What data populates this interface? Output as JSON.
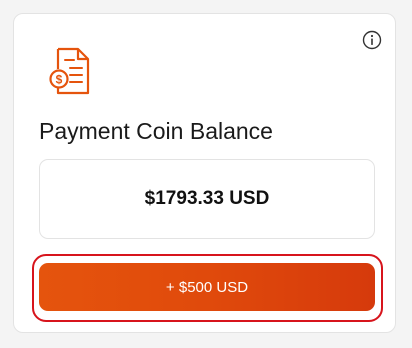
{
  "card": {
    "title": "Payment Coin Balance",
    "balance": "$1793.33 USD",
    "add_button_label": "+ $500 USD"
  },
  "icons": {
    "info": "info-icon",
    "document": "invoice-document-icon"
  },
  "colors": {
    "accent": "#e5540d",
    "accent_dark": "#d63a0c",
    "focus_ring": "#d7141c"
  }
}
